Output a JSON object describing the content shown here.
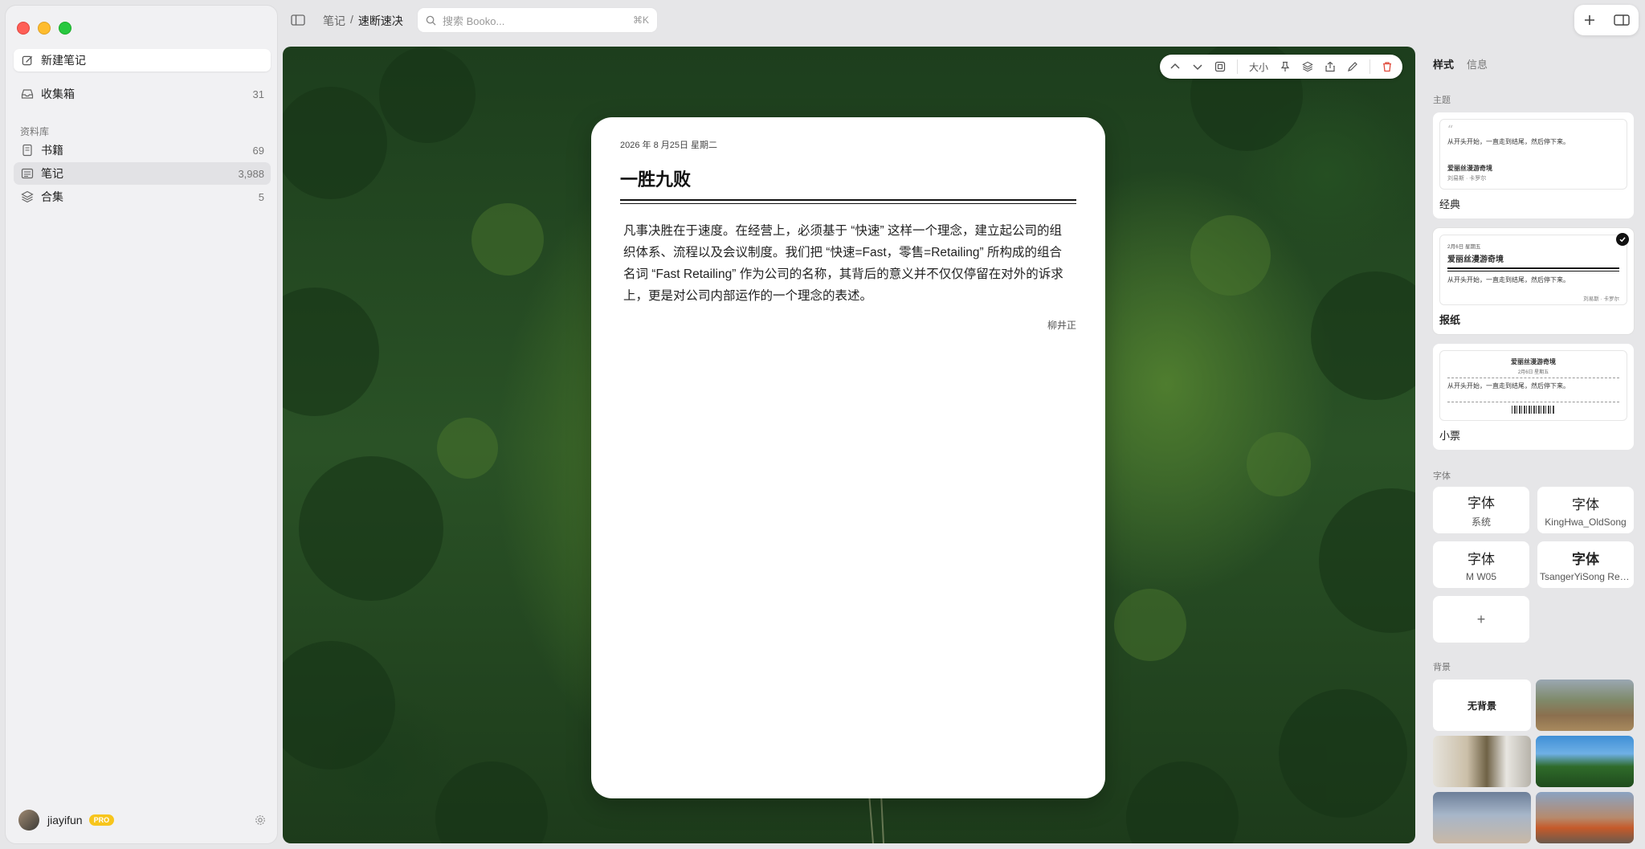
{
  "sidebar": {
    "new_note": "新建笔记",
    "inbox": {
      "label": "收集箱",
      "count": "31"
    },
    "library_label": "资料库",
    "items": [
      {
        "label": "书籍",
        "count": "69"
      },
      {
        "label": "笔记",
        "count": "3,988"
      },
      {
        "label": "合集",
        "count": "5"
      }
    ],
    "user": {
      "name": "jiayifun",
      "badge": "PRO"
    }
  },
  "topbar": {
    "breadcrumb_root": "笔记",
    "breadcrumb_sep": "/",
    "breadcrumb_current": "速断速决",
    "search_placeholder": "搜索 Booko...",
    "search_shortcut": "⌘K"
  },
  "toolbar": {
    "font_size_label": "大小"
  },
  "note": {
    "date": "2026 年 8 月25日 星期二",
    "title": "一胜九败",
    "body": "凡事决胜在于速度。在经营上，必须基于 “快速” 这样一个理念，建立起公司的组织体系、流程以及会议制度。我们把 “快速=Fast，零售=Retailing” 所构成的组合名词 “Fast Retailing” 作为公司的名称，其背后的意义并不仅仅停留在对外的诉求上，更是对公司内部运作的一个理念的表述。",
    "author": "柳井正"
  },
  "panel": {
    "tab_style": "样式",
    "tab_info": "信息",
    "theme_label": "主题",
    "themes": [
      {
        "name": "经典",
        "quote_mark": "“",
        "line": "从开头开始，一直走到结尾，然后停下来。",
        "book": "爱丽丝漫游奇境",
        "author": "刘易斯 · 卡罗尔"
      },
      {
        "name": "报纸",
        "date": "2月6日 星期五",
        "book": "爱丽丝漫游奇境",
        "line": "从开头开始，一直走到结尾，然后停下来。",
        "author": "刘易斯 · 卡罗尔"
      },
      {
        "name": "小票",
        "book": "爱丽丝漫游奇境",
        "date": "2月6日 星期五",
        "line": "从开头开始，一直走到结尾，然后停下来。"
      }
    ],
    "font_label": "字体",
    "fonts": [
      {
        "sample": "字体",
        "name": "系统"
      },
      {
        "sample": "字体",
        "name": "KingHwa_OldSong"
      },
      {
        "sample": "字体",
        "name": "M W05"
      },
      {
        "sample": "字体",
        "name": "TsangerYiSong Reg..."
      }
    ],
    "add_font": "+",
    "background_label": "背景",
    "no_background": "无背景"
  },
  "colors": {
    "accent_delete": "#e04a3b",
    "pro_badge": "#f7c51c"
  }
}
